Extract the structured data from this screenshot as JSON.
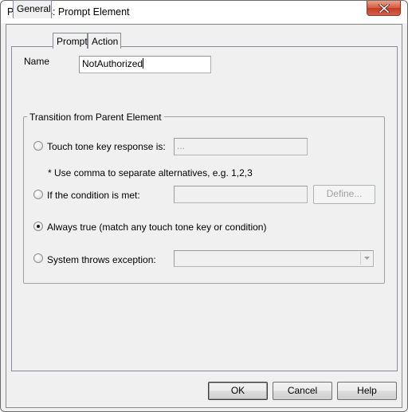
{
  "window": {
    "title": "Properties: Prompt Element",
    "close_icon": "close-x-icon"
  },
  "tabs": [
    {
      "label": "General",
      "active": true
    },
    {
      "label": "Prompt",
      "active": false
    },
    {
      "label": "Action",
      "active": false
    }
  ],
  "general": {
    "name_label": "Name",
    "name_value": "NotAuthorized",
    "group_title": "Transition from Parent Element",
    "options": {
      "touch_tone": {
        "label": "Touch tone key response is:",
        "value": "...",
        "selected": false,
        "enabled": false
      },
      "hint": "* Use comma to separate alternatives, e.g. 1,2,3",
      "condition": {
        "label": "If the condition is met:",
        "value": "",
        "define_label": "Define...",
        "selected": false,
        "enabled": false
      },
      "always_true": {
        "label": "Always true (match any touch tone key or condition)",
        "selected": true
      },
      "exception": {
        "label": "System throws exception:",
        "value": "",
        "selected": false,
        "enabled": false,
        "dropdown_icon": "chevron-down-icon"
      }
    }
  },
  "buttons": {
    "ok": "OK",
    "cancel": "Cancel",
    "help": "Help"
  }
}
